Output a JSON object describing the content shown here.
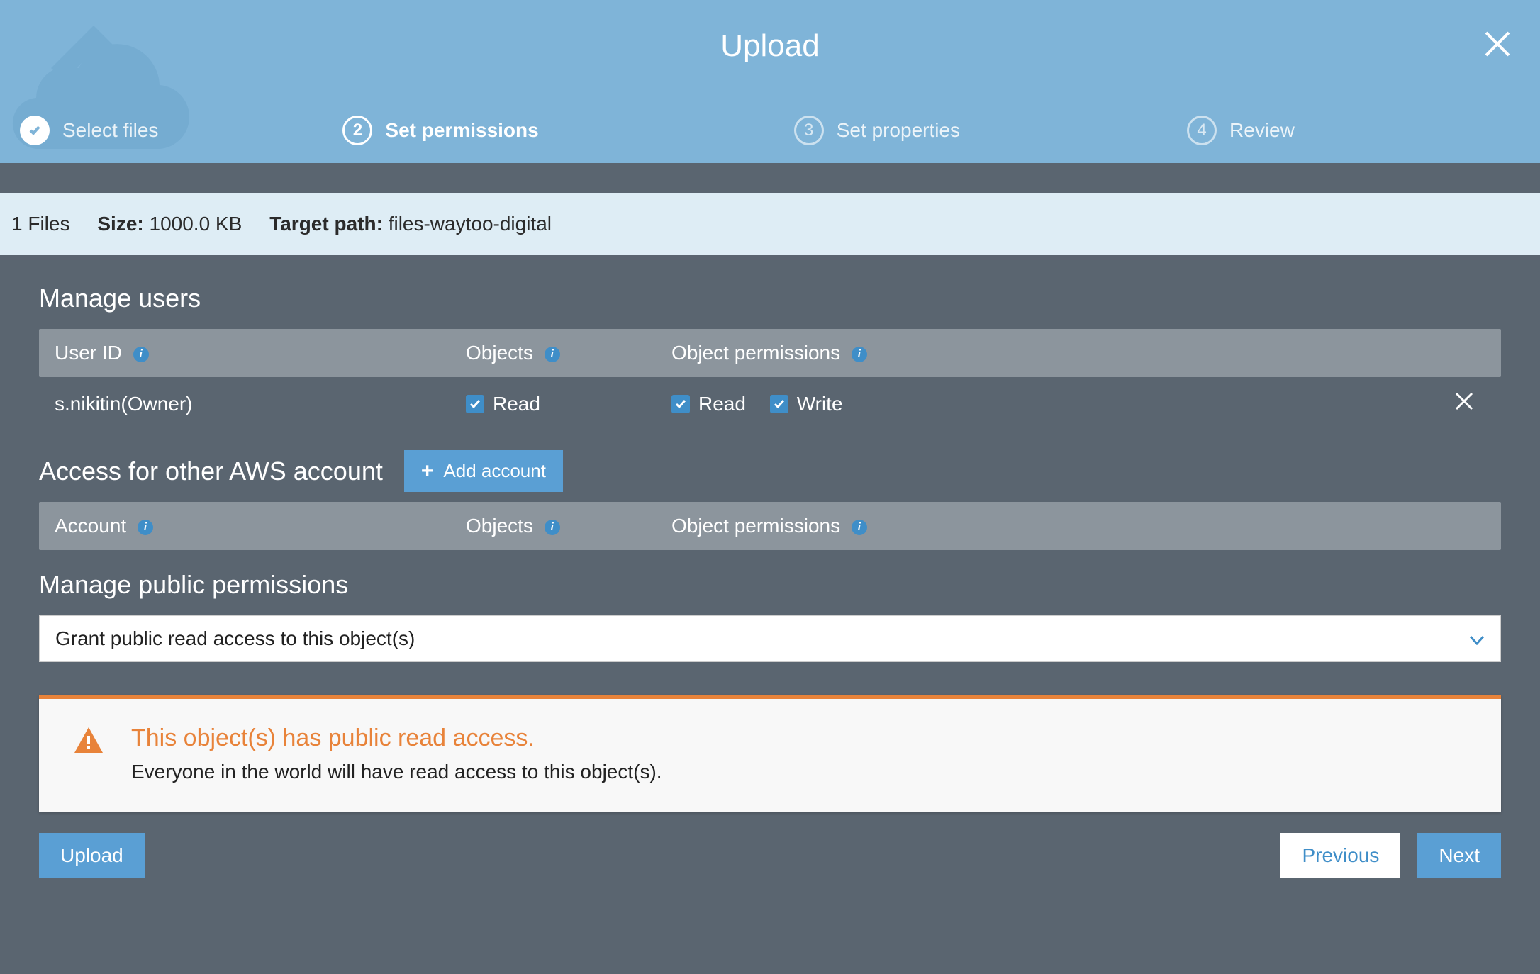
{
  "header": {
    "title": "Upload",
    "steps": [
      {
        "num": "✓",
        "label": "Select files",
        "state": "done"
      },
      {
        "num": "2",
        "label": "Set permissions",
        "state": "active"
      },
      {
        "num": "3",
        "label": "Set properties",
        "state": ""
      },
      {
        "num": "4",
        "label": "Review",
        "state": ""
      }
    ]
  },
  "info": {
    "files_count": "1 Files",
    "size_label": "Size:",
    "size_value": "1000.0 KB",
    "target_label": "Target path:",
    "target_value": "files-waytoo-digital"
  },
  "manage_users": {
    "title": "Manage users",
    "columns": {
      "user_id": "User ID",
      "objects": "Objects",
      "permissions": "Object permissions"
    },
    "rows": [
      {
        "user": "s.nikitin(Owner)",
        "objects_read": true,
        "perm_read": true,
        "perm_write": true,
        "labels": {
          "read": "Read",
          "write": "Write"
        }
      }
    ]
  },
  "other_accounts": {
    "title": "Access for other AWS account",
    "add_button": "Add account",
    "columns": {
      "account": "Account",
      "objects": "Objects",
      "permissions": "Object permissions"
    }
  },
  "public_permissions": {
    "title": "Manage public permissions",
    "selected": "Grant public read access to this object(s)"
  },
  "warning": {
    "title": "This object(s) has public read access.",
    "body": "Everyone in the world will have read access to this object(s)."
  },
  "footer": {
    "upload": "Upload",
    "previous": "Previous",
    "next": "Next"
  },
  "colors": {
    "accent": "#5a9fd4",
    "warning": "#e8833a"
  }
}
